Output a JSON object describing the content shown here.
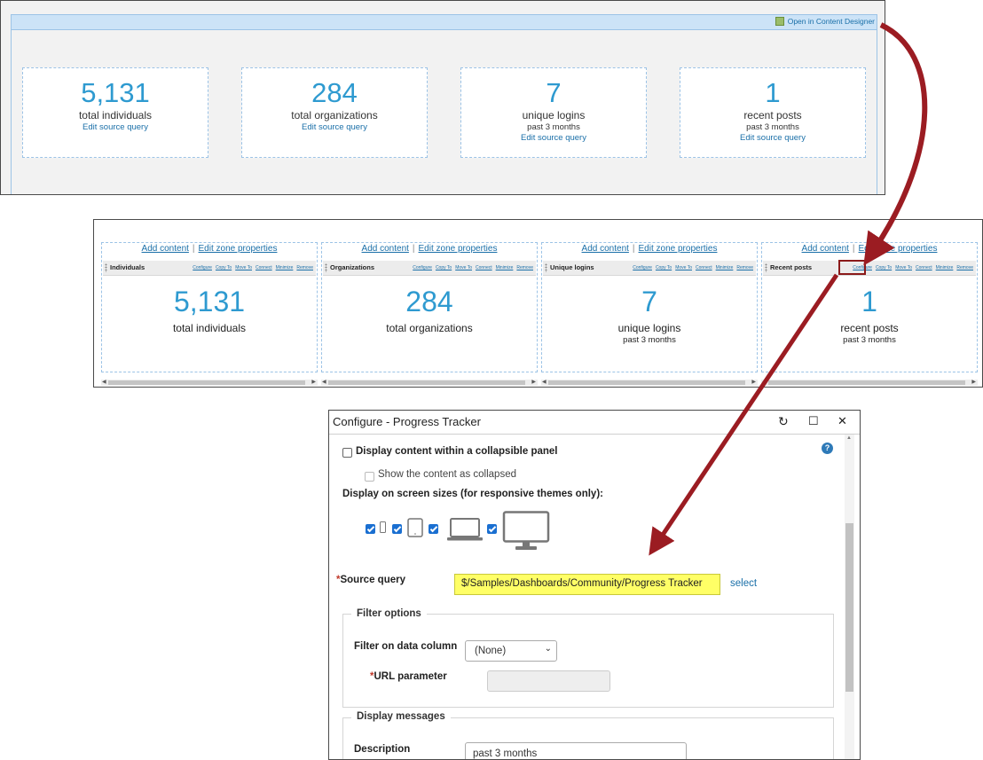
{
  "panel1": {
    "designer_link": "Open in Content Designer",
    "cards": [
      {
        "number": "5,131",
        "label": "total individuals",
        "sub": "",
        "edit": "Edit source query"
      },
      {
        "number": "284",
        "label": "total organizations",
        "sub": "",
        "edit": "Edit source query"
      },
      {
        "number": "7",
        "label": "unique logins",
        "sub": "past 3 months",
        "edit": "Edit source query"
      },
      {
        "number": "1",
        "label": "recent posts",
        "sub": "past 3 months",
        "edit": "Edit source query"
      }
    ]
  },
  "panel2": {
    "add_content": "Add content",
    "separator": "|",
    "edit_zone": "Edit zone properties",
    "webpart_links": [
      "Configure",
      "Copy To",
      "Move To",
      "Connect",
      "Minimize",
      "Remove"
    ],
    "zones": [
      {
        "title": "Individuals",
        "number": "5,131",
        "label": "total individuals",
        "sub": ""
      },
      {
        "title": "Organizations",
        "number": "284",
        "label": "total organizations",
        "sub": ""
      },
      {
        "title": "Unique logins",
        "number": "7",
        "label": "unique logins",
        "sub": "past 3 months"
      },
      {
        "title": "Recent posts",
        "number": "1",
        "label": "recent posts",
        "sub": "past 3 months"
      }
    ]
  },
  "dialog": {
    "title": "Configure - Progress Tracker",
    "collapsible_label": "Display content within a collapsible panel",
    "collapsed_label": "Show the content as collapsed",
    "screen_sizes_label": "Display on screen sizes (for responsive themes only):",
    "source_query_label": "Source query",
    "required_mark": "*",
    "source_query_value": "$/Samples/Dashboards/Community/Progress Tracker",
    "select_link": "select",
    "filter_options_legend": "Filter options",
    "filter_column_label": "Filter on data column",
    "filter_column_value": "(None)",
    "url_parameter_label": "URL parameter",
    "display_messages_legend": "Display messages",
    "description_label": "Description",
    "description_value": "past 3 months",
    "help_glyph": "?",
    "refresh_glyph": "↻",
    "maximize_glyph": "☐",
    "close_glyph": "✕"
  },
  "colors": {
    "accent_number": "#2e9ad0",
    "link": "#1a6fa8",
    "arrow": "#9b1c22",
    "highlight": "#ffff66"
  }
}
